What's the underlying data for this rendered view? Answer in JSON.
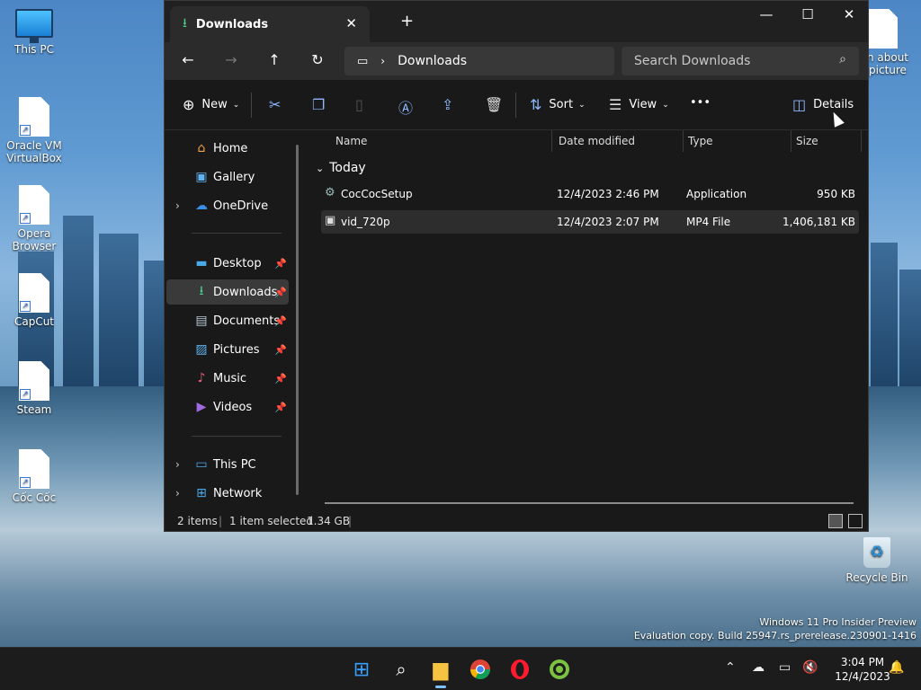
{
  "desktop": {
    "icons": [
      {
        "label": "This PC",
        "type": "monitor"
      },
      {
        "label": "Oracle VM VirtualBox",
        "type": "shortcut"
      },
      {
        "label": "Opera Browser",
        "type": "shortcut"
      },
      {
        "label": "CapCut",
        "type": "shortcut"
      },
      {
        "label": "Steam",
        "type": "shortcut"
      },
      {
        "label": "Cốc Cốc",
        "type": "shortcut"
      }
    ],
    "partial_icon_label": "n about picture",
    "recycle_bin": "Recycle Bin",
    "watermark_line1": "Windows 11 Pro Insider Preview",
    "watermark_line2": "Evaluation copy. Build 25947.rs_prerelease.230901-1416"
  },
  "explorer": {
    "tab_title": "Downloads",
    "address": "Downloads",
    "search_placeholder": "Search Downloads",
    "toolbar": {
      "new_label": "New",
      "sort_label": "Sort",
      "view_label": "View",
      "more_label": "•••",
      "details_label": "Details"
    },
    "sidebar": {
      "home": "Home",
      "gallery": "Gallery",
      "onedrive": "OneDrive",
      "desktop": "Desktop",
      "downloads": "Downloads",
      "documents": "Documents",
      "pictures": "Pictures",
      "music": "Music",
      "videos": "Videos",
      "thispc": "This PC",
      "network": "Network"
    },
    "columns": {
      "name": "Name",
      "date": "Date modified",
      "type": "Type",
      "size": "Size"
    },
    "group_label": "Today",
    "files": [
      {
        "name": "CocCocSetup",
        "date": "12/4/2023 2:46 PM",
        "type": "Application",
        "size": "950 KB"
      },
      {
        "name": "vid_720p",
        "date": "12/4/2023 2:07 PM",
        "type": "MP4 File",
        "size": "1,406,181 KB"
      }
    ],
    "status": {
      "items": "2 items",
      "selected": "1 item selected",
      "selected_size": "1.34 GB"
    }
  },
  "taskbar": {
    "time": "3:04 PM",
    "date": "12/4/2023"
  },
  "colors": {
    "accent": "#7cc3ff",
    "window_bg": "#191919"
  }
}
